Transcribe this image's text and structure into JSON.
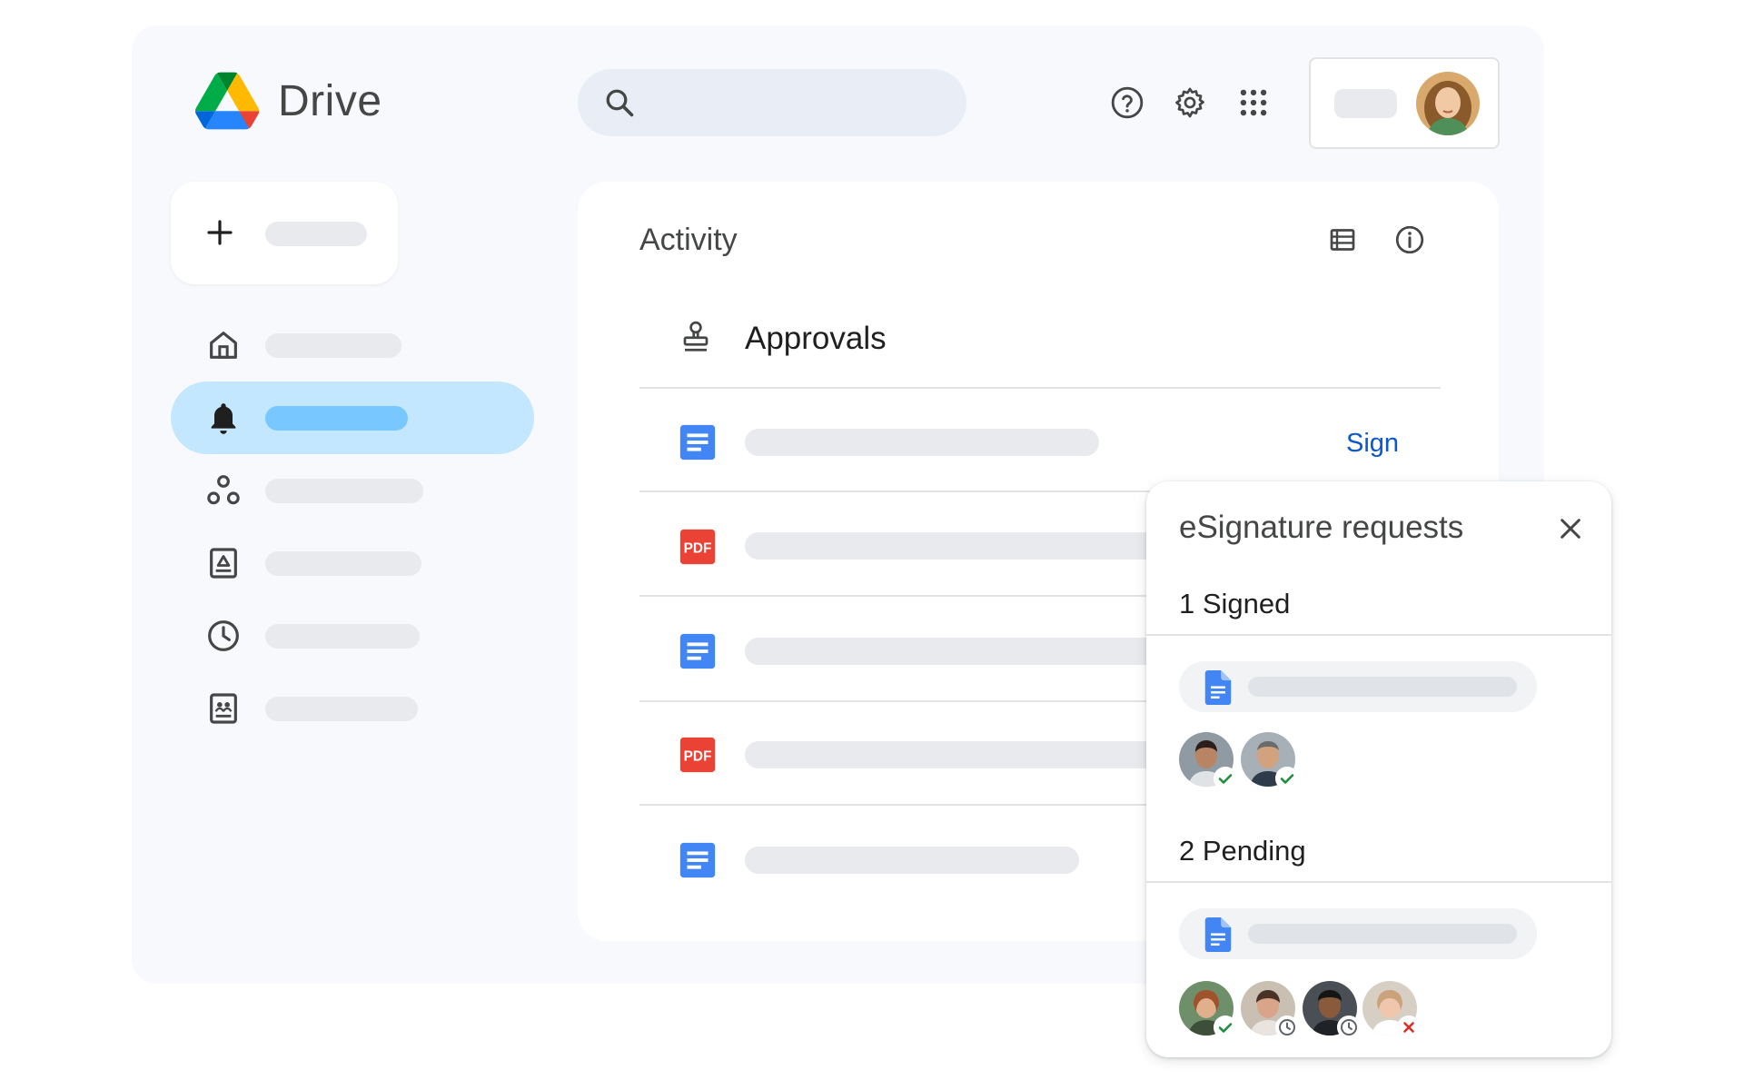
{
  "header": {
    "app_name": "Drive",
    "icons": [
      "drive-logo",
      "search-icon",
      "help-icon",
      "settings-icon",
      "apps-grid-icon",
      "account-avatar"
    ]
  },
  "sidebar": {
    "items": [
      {
        "icon": "home-icon",
        "active": false
      },
      {
        "icon": "bell-icon",
        "active": true
      },
      {
        "icon": "shared-icon",
        "active": false
      },
      {
        "icon": "drive-folder-icon",
        "active": false
      },
      {
        "icon": "clock-icon",
        "active": false
      },
      {
        "icon": "shared-drives-icon",
        "active": false
      }
    ]
  },
  "activity": {
    "title": "Activity",
    "section": "Approvals",
    "rows": [
      {
        "type": "doc",
        "action": "Sign"
      },
      {
        "type": "pdf"
      },
      {
        "type": "doc"
      },
      {
        "type": "pdf"
      },
      {
        "type": "doc"
      }
    ]
  },
  "popup": {
    "title": "eSignature requests",
    "signed_label": "1 Signed",
    "pending_label": "2 Pending",
    "signed_signers": [
      "signed",
      "signed"
    ],
    "pending_signers": [
      "signed",
      "pending",
      "pending",
      "declined"
    ]
  },
  "colors": {
    "accent_blue": "#0b57d0",
    "active_nav": "#c2e7ff",
    "doc_blue": "#4285f4",
    "pdf_red": "#ea4335",
    "check_green": "#1e8e3e"
  }
}
